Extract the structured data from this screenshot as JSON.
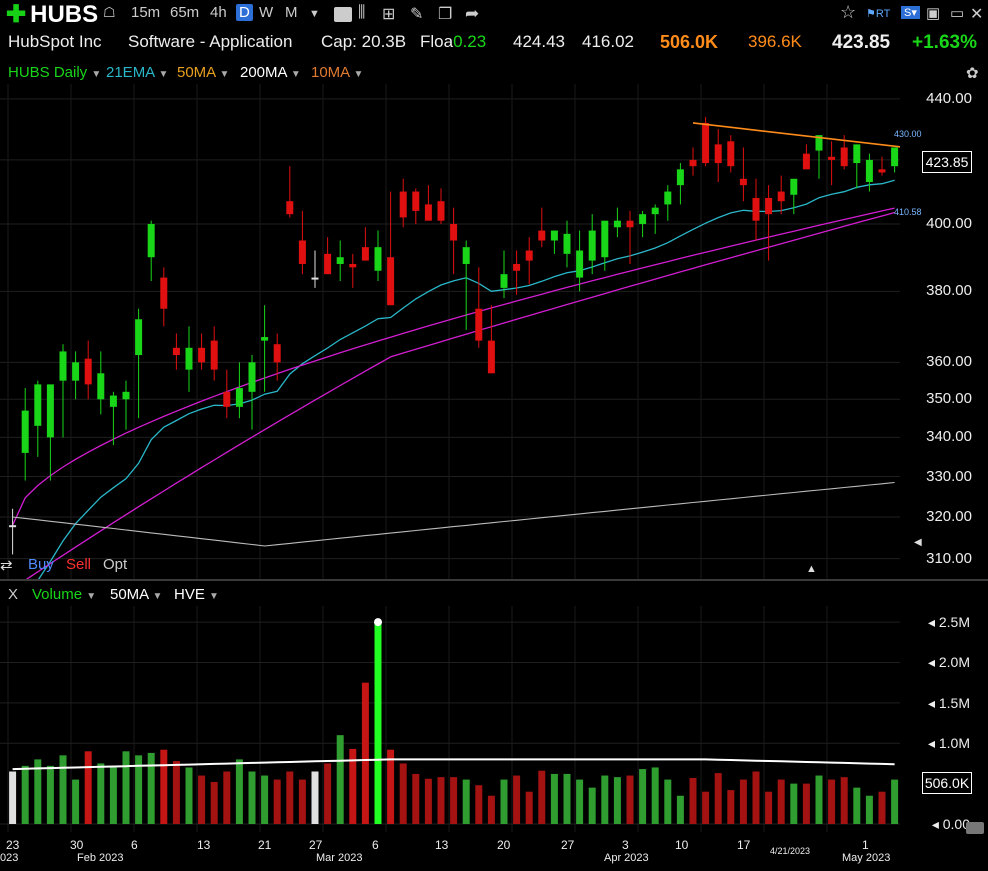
{
  "toolbar": {
    "symbol": "HUBS",
    "intervals": [
      "15m",
      "65m",
      "4h",
      "D",
      "W",
      "M"
    ],
    "active_interval": "D"
  },
  "quote": {
    "company": "HubSpot Inc",
    "sector": "Software - Application",
    "cap_label": "Cap:",
    "cap_value": "20.3B",
    "float_label": "Floa",
    "float_value": "0.23",
    "high": "424.43",
    "low": "416.02",
    "volume": "506.0K",
    "avg_volume": "396.6K",
    "last": "423.85",
    "change": "+1.63%"
  },
  "indicators": {
    "main": "HUBS Daily",
    "ema21": "21EMA",
    "ma50": "50MA",
    "ma200": "200MA",
    "ma10": "10MA"
  },
  "trade": {
    "buy": "Buy",
    "sell": "Sell",
    "opt": "Opt"
  },
  "volume_panel": {
    "close": "X",
    "label": "Volume",
    "ma": "50MA",
    "hve": "HVE"
  },
  "price_axis": [
    "440.00",
    "420.00",
    "400.00",
    "380.00",
    "360.00",
    "350.00",
    "340.00",
    "330.00",
    "320.00",
    "310.00"
  ],
  "price_axis_values": [
    440,
    420,
    400,
    380,
    360,
    350,
    340,
    330,
    320,
    310
  ],
  "price_current": "423.85",
  "alert_high": "430.00",
  "alert_low": "410.58",
  "volume_axis": [
    "2.5M",
    "2.0M",
    "1.5M",
    "1.0M",
    "0.00"
  ],
  "volume_axis_values": [
    2.5,
    2.0,
    1.5,
    1.0,
    0.0
  ],
  "volume_current": "506.0K",
  "date_ticks": [
    "23",
    "30",
    "6",
    "13",
    "21",
    "27",
    "6",
    "13",
    "20",
    "27",
    "3",
    "10",
    "17",
    "1"
  ],
  "month_labels": [
    "023",
    "Feb 2023",
    "Mar 2023",
    "Apr 2023",
    "4/21/2023",
    "May 2023"
  ],
  "colors": {
    "up": "#19d619",
    "down": "#e01010",
    "neutral": "#e0e0e0",
    "ema21": "#2ab7c9",
    "ma50": "#d21ed2",
    "ma200": "#bbbbbb",
    "trendline": "#ff8c1a",
    "volume_ma": "#ffffff"
  },
  "chart_data": {
    "type": "candlestick",
    "candles": [
      [
        318,
        322,
        311,
        318
      ],
      [
        336,
        353,
        329,
        347
      ],
      [
        343,
        355,
        335,
        354
      ],
      [
        340,
        350,
        329,
        354
      ],
      [
        355,
        365,
        340,
        363
      ],
      [
        355,
        363,
        350,
        360
      ],
      [
        361,
        366,
        350,
        354
      ],
      [
        350,
        363,
        346,
        357
      ],
      [
        348,
        352,
        338,
        351
      ],
      [
        350,
        355,
        342,
        352
      ],
      [
        362,
        375,
        345,
        372
      ],
      [
        390,
        401,
        383,
        400
      ],
      [
        384,
        387,
        370,
        375
      ],
      [
        364,
        368,
        358,
        362
      ],
      [
        358,
        370,
        352,
        364
      ],
      [
        364,
        368,
        358,
        360
      ],
      [
        366,
        370,
        355,
        358
      ],
      [
        352,
        358,
        345,
        348
      ],
      [
        348,
        360,
        345,
        353
      ],
      [
        352,
        362,
        342,
        360
      ],
      [
        366,
        376,
        352,
        367
      ],
      [
        365,
        368,
        355,
        360
      ],
      [
        407,
        418,
        402,
        403
      ],
      [
        395,
        404,
        385,
        388
      ],
      [
        384,
        392,
        381,
        384
      ],
      [
        391,
        396,
        385,
        385
      ],
      [
        388,
        395,
        383,
        390
      ],
      [
        388,
        391,
        381,
        387
      ],
      [
        393,
        399,
        389,
        389
      ],
      [
        386,
        398,
        383,
        393
      ],
      [
        390,
        410,
        376,
        376
      ],
      [
        410,
        414,
        399,
        402
      ],
      [
        410,
        411,
        400,
        404
      ],
      [
        406,
        412,
        403,
        401
      ],
      [
        407,
        411,
        400,
        401
      ],
      [
        400,
        405,
        385,
        395
      ],
      [
        388,
        395,
        369,
        393
      ],
      [
        375,
        387,
        364,
        366
      ],
      [
        366,
        376,
        357,
        357
      ],
      [
        381,
        392,
        378,
        385
      ],
      [
        388,
        392,
        379,
        386
      ],
      [
        392,
        396,
        382,
        389
      ],
      [
        398,
        405,
        393,
        395
      ],
      [
        395,
        398,
        391,
        398
      ],
      [
        391,
        401,
        387,
        397
      ],
      [
        384,
        398,
        380,
        392
      ],
      [
        389,
        403,
        385,
        398
      ],
      [
        390,
        400,
        386,
        401
      ],
      [
        399,
        405,
        396,
        401
      ],
      [
        401,
        404,
        388,
        399
      ],
      [
        400,
        404,
        396,
        403
      ],
      [
        403,
        406,
        397,
        405
      ],
      [
        406,
        412,
        401,
        410
      ],
      [
        412,
        419,
        406,
        417
      ],
      [
        420,
        424,
        415,
        418
      ],
      [
        432,
        434,
        418,
        419
      ],
      [
        425,
        430,
        413,
        419
      ],
      [
        426,
        428,
        416,
        418
      ],
      [
        414,
        424,
        407,
        412
      ],
      [
        408,
        414,
        395,
        401
      ],
      [
        408,
        412,
        389,
        403
      ],
      [
        410,
        415,
        403,
        407
      ],
      [
        409,
        414,
        403,
        414
      ],
      [
        422,
        425,
        417,
        417
      ],
      [
        423,
        426,
        414,
        428
      ],
      [
        421,
        426,
        412,
        420
      ],
      [
        424,
        428,
        417,
        418
      ],
      [
        419,
        425,
        411,
        425
      ],
      [
        413,
        422,
        410,
        420
      ],
      [
        417,
        421,
        415,
        416
      ],
      [
        418,
        424,
        416,
        424
      ]
    ],
    "volume_millions": [
      0.65,
      0.72,
      0.8,
      0.72,
      0.85,
      0.55,
      0.9,
      0.75,
      0.7,
      0.9,
      0.85,
      0.88,
      0.92,
      0.78,
      0.7,
      0.6,
      0.52,
      0.65,
      0.8,
      0.65,
      0.6,
      0.55,
      0.65,
      0.55,
      0.65,
      0.75,
      1.1,
      0.93,
      1.75,
      2.5,
      0.92,
      0.75,
      0.62,
      0.56,
      0.58,
      0.58,
      0.55,
      0.48,
      0.35,
      0.55,
      0.6,
      0.4,
      0.66,
      0.62,
      0.62,
      0.55,
      0.45,
      0.6,
      0.58,
      0.6,
      0.68,
      0.7,
      0.55,
      0.35,
      0.57,
      0.4,
      0.63,
      0.42,
      0.55,
      0.65,
      0.4,
      0.55,
      0.5,
      0.5,
      0.6,
      0.55,
      0.58,
      0.45,
      0.35,
      0.4,
      0.55
    ],
    "ylim": [
      305,
      445
    ],
    "volume_ylim": [
      0,
      2.6
    ],
    "trendline": [
      [
        55,
        432
      ],
      [
        70,
        424
      ]
    ]
  }
}
